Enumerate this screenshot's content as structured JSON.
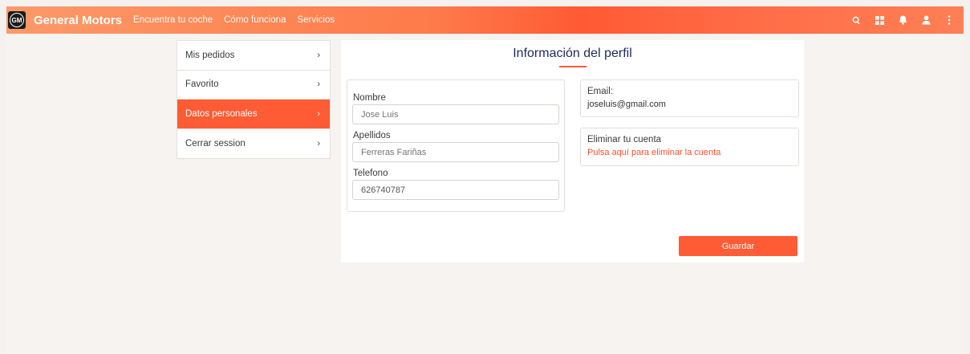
{
  "header": {
    "logo_text": "GM",
    "brand": "General Motors",
    "nav": [
      "Encuentra tu coche",
      "Cómo funciona",
      "Servicios"
    ],
    "icons": [
      "search-icon",
      "grid-icon",
      "bell-icon",
      "user-icon",
      "more-vert-icon"
    ],
    "accent": "#ff5b34"
  },
  "sidebar": {
    "items": [
      {
        "label": "Mis pedidos",
        "active": false
      },
      {
        "label": "Favorito",
        "active": false
      },
      {
        "label": "Datos personales",
        "active": true
      },
      {
        "label": "Cerrar session",
        "active": false
      }
    ],
    "chevron": "›"
  },
  "profile": {
    "title": "Información del perfil",
    "fields": {
      "nombre_label": "Nombre",
      "nombre_placeholder": "Jose Luis",
      "apellidos_label": "Apellidos",
      "apellidos_placeholder": "Ferreras Fariñas",
      "telefono_label": "Telefono",
      "telefono_value": "626740787"
    },
    "email_label": "Email:",
    "email_value": "joseluis@gmail.com",
    "delete_title": "Eliminar tu cuenta",
    "delete_link": "Pulsa aquí para eliminar la cuenta",
    "save_label": "Guardar"
  }
}
